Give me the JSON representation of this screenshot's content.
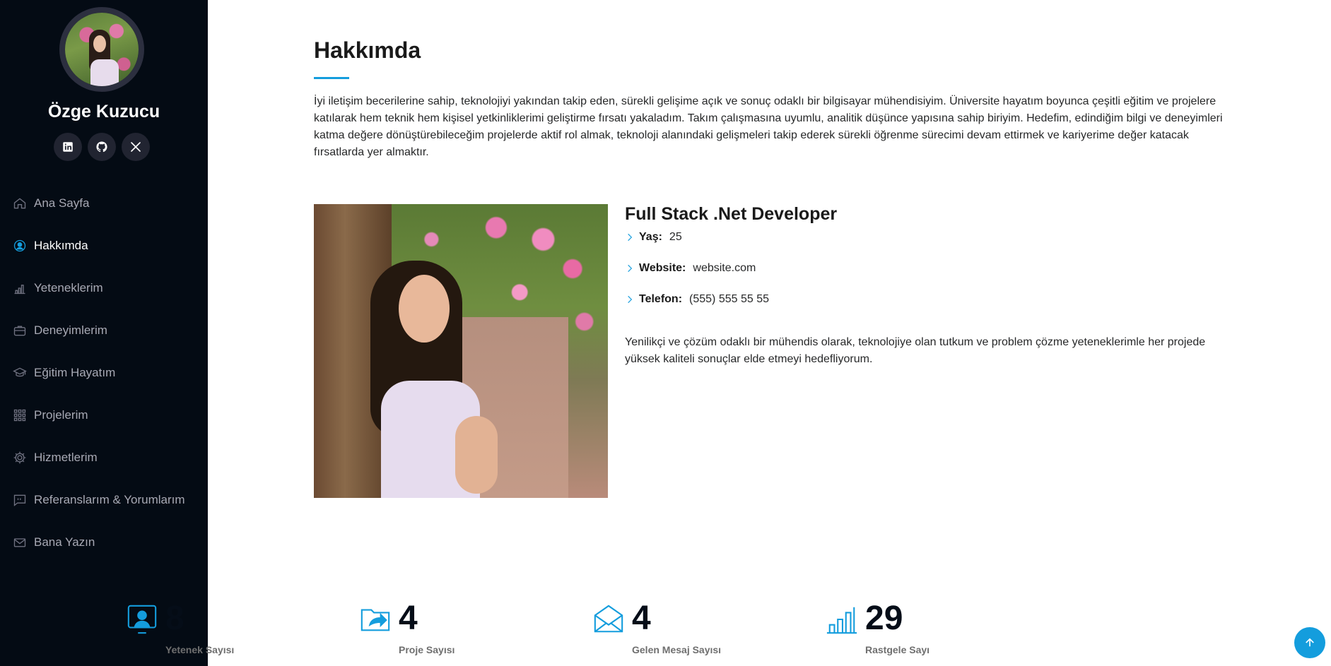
{
  "profile": {
    "name": "Özge Kuzucu"
  },
  "socials": [
    "linkedin-icon",
    "github-icon",
    "x-twitter-icon"
  ],
  "nav": {
    "items": [
      {
        "label": "Ana Sayfa",
        "icon": "home-icon",
        "active": false
      },
      {
        "label": "Hakkımda",
        "icon": "user-icon",
        "active": true
      },
      {
        "label": "Yeteneklerim",
        "icon": "bar-chart-icon",
        "active": false
      },
      {
        "label": "Deneyimlerim",
        "icon": "briefcase-icon",
        "active": false
      },
      {
        "label": "Eğitim Hayatım",
        "icon": "graduation-cap-icon",
        "active": false
      },
      {
        "label": "Projelerim",
        "icon": "grid-icon",
        "active": false
      },
      {
        "label": "Hizmetlerim",
        "icon": "gear-icon",
        "active": false
      },
      {
        "label": "Referanslarım & Yorumlarım",
        "icon": "quote-chat-icon",
        "active": false
      },
      {
        "label": "Bana Yazın",
        "icon": "envelope-icon",
        "active": false
      }
    ]
  },
  "about": {
    "title": "Hakkımda",
    "intro": "İyi iletişim becerilerine sahip, teknolojiyi yakından takip eden, sürekli gelişime açık ve sonuç odaklı bir bilgisayar mühendisiyim. Üniversite hayatım boyunca çeşitli eğitim ve projelere katılarak hem teknik hem kişisel yetkinliklerimi geliştirme fırsatı yakaladım. Takım çalışmasına uyumlu, analitik düşünce yapısına sahip biriyim. Hedefim, edindiğim bilgi ve deneyimleri katma değere dönüştürebileceğim projelerde aktif rol almak, teknoloji alanındaki gelişmeleri takip ederek sürekli öğrenme sürecimi devam ettirmek ve kariyerime değer katacak fırsatlarda yer almaktır.",
    "role": "Full Stack .Net Developer",
    "facts": [
      {
        "label": "Yaş:",
        "value": "25"
      },
      {
        "label": "Website:",
        "value": "website.com"
      },
      {
        "label": "Telefon:",
        "value": "(555) 555 55 55"
      }
    ],
    "summary": "Yenilikçi ve çözüm odaklı bir mühendis olarak, teknolojiye olan tutkum ve problem çözme yeteneklerimle her projede yüksek kaliteli sonuçlar elde etmeyi hedefliyorum."
  },
  "stats": [
    {
      "value": "8",
      "label": "Yetenek Sayısı",
      "icon": "user-screen-icon"
    },
    {
      "value": "4",
      "label": "Proje Sayısı",
      "icon": "folder-share-icon"
    },
    {
      "value": "4",
      "label": "Gelen Mesaj Sayısı",
      "icon": "envelope-open-icon"
    },
    {
      "value": "29",
      "label": "Rastgele Sayı",
      "icon": "bar-chart-icon"
    }
  ],
  "colors": {
    "accent": "#149ddd",
    "sidebar_bg": "#040b14",
    "social_bg": "#212431"
  }
}
